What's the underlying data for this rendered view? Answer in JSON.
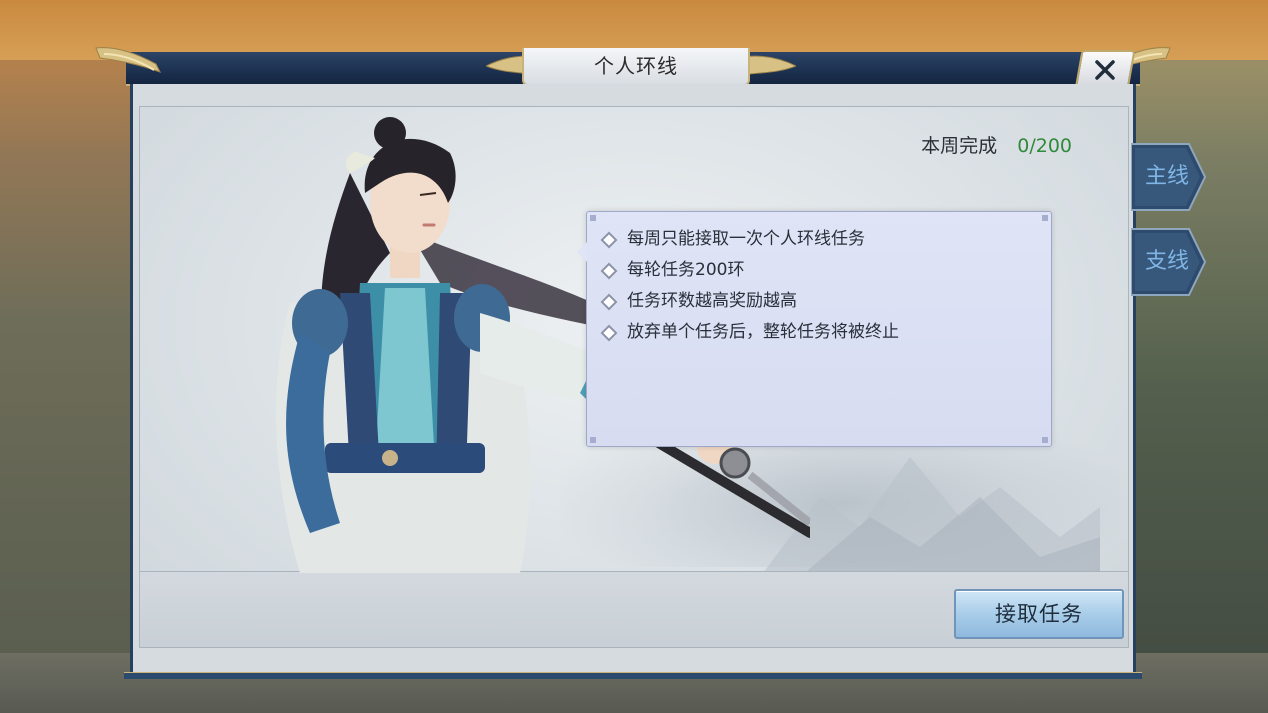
{
  "window": {
    "title": "个人环线"
  },
  "weekly_progress": {
    "label": "本周完成",
    "value": "0/200"
  },
  "rules": [
    "每周只能接取一次个人环线任务",
    "每轮任务200环",
    "任务环数越高奖励越高",
    "放弃单个任务后，整轮任务将被终止"
  ],
  "accept_button": {
    "label": "接取任务"
  },
  "side_tabs": [
    {
      "label": "主线"
    },
    {
      "label": "支线"
    }
  ],
  "icons": {
    "close": "close-icon",
    "bullet": "diamond-icon"
  },
  "colors": {
    "progress_value": "#2f8a3a",
    "tab_text": "#7fb6e6",
    "frame": "#26405f",
    "gold_trim": "#c9b37a"
  }
}
